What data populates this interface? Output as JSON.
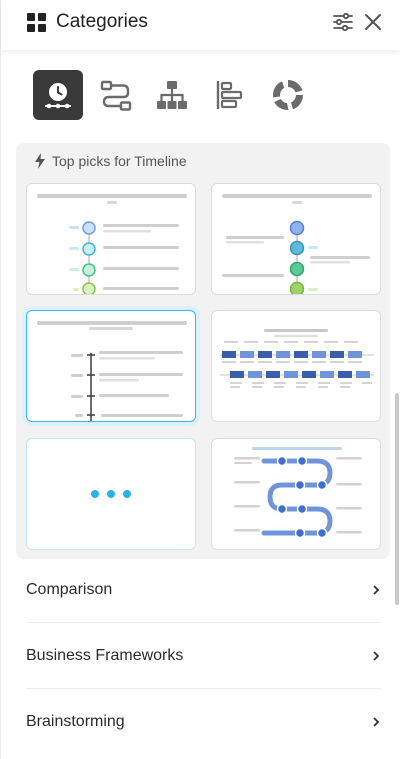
{
  "header": {
    "title": "Categories",
    "icons": [
      "grid-icon",
      "filter-sliders-icon",
      "close-icon"
    ]
  },
  "types": [
    {
      "name": "timeline",
      "icon": "clock-timeline-icon",
      "active": true
    },
    {
      "name": "process",
      "icon": "process-flow-icon",
      "active": false
    },
    {
      "name": "hierarchy",
      "icon": "hierarchy-icon",
      "active": false
    },
    {
      "name": "gantt",
      "icon": "bar-list-icon",
      "active": false
    },
    {
      "name": "cycle",
      "icon": "cycle-icon",
      "active": false
    }
  ],
  "picks": {
    "heading": "Top picks for Timeline",
    "icon": "lightning-icon",
    "more_icon": "more-dots-icon"
  },
  "categories": [
    {
      "label": "Comparison"
    },
    {
      "label": "Business Frameworks"
    },
    {
      "label": "Brainstorming"
    }
  ],
  "colors": {
    "accent": "#29b0e6",
    "active_bg": "#3a3a3a",
    "panel_bg": "#f2f2f2"
  }
}
